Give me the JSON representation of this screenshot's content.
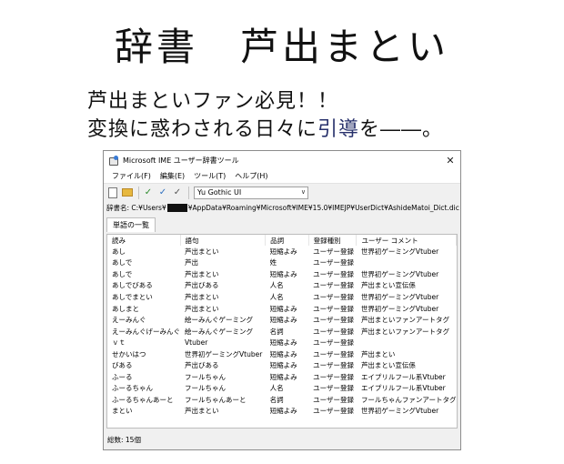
{
  "poster": {
    "title": "辞書　芦出まとい",
    "headline_line1": "芦出まといファン必見！！",
    "headline_line2_a": "変換に惑わされる日々に",
    "headline_line2_b": "引導",
    "headline_line2_c": "を――。"
  },
  "window": {
    "title": "Microsoft IME ユーザー辞書ツール",
    "close_glyph": "✕",
    "menu": [
      "ファイル(F)",
      "編集(E)",
      "ツール(T)",
      "ヘルプ(H)"
    ],
    "font_select_value": "Yu Gothic UI",
    "dict_path_prefix": "辞書名: C:¥Users¥",
    "dict_path_suffix": "¥AppData¥Roaming¥Microsoft¥IME¥15.0¥IMEJP¥UserDict¥AshideMatoi_Dict.dic",
    "tab_label": "単語の一覧",
    "columns": [
      "読み",
      "語句",
      "品詞",
      "登録種別",
      "ユーザー コメント"
    ],
    "rows": [
      [
        "あし",
        "芦出まとい",
        "短縮よみ",
        "ユーザー登録",
        "世界初ゲーミングVtuber"
      ],
      [
        "あしで",
        "芦出",
        "姓",
        "ユーザー登録",
        ""
      ],
      [
        "あしで",
        "芦出まとい",
        "短縮よみ",
        "ユーザー登録",
        "世界初ゲーミングVtuber"
      ],
      [
        "あしでびある",
        "芦出びある",
        "人名",
        "ユーザー登録",
        "芦出まとい宣伝係"
      ],
      [
        "あしでまとい",
        "芦出まとい",
        "人名",
        "ユーザー登録",
        "世界初ゲーミングVtuber"
      ],
      [
        "あしまと",
        "芦出まとい",
        "短縮よみ",
        "ユーザー登録",
        "世界初ゲーミングVtuber"
      ],
      [
        "えーみんぐ",
        "絵ーみんぐゲーミング",
        "短縮よみ",
        "ユーザー登録",
        "芦出まといファンアートタグ"
      ],
      [
        "えーみんぐげーみんぐ",
        "絵ーみんぐゲーミング",
        "名詞",
        "ユーザー登録",
        "芦出まといファンアートタグ"
      ],
      [
        "ｖｔ",
        "Vtuber",
        "短縮よみ",
        "ユーザー登録",
        ""
      ],
      [
        "せかいはつ",
        "世界初ゲーミングVtuber",
        "短縮よみ",
        "ユーザー登録",
        "芦出まとい"
      ],
      [
        "びある",
        "芦出びある",
        "短縮よみ",
        "ユーザー登録",
        "芦出まとい宣伝係"
      ],
      [
        "ふーる",
        "フールちゃん",
        "短縮よみ",
        "ユーザー登録",
        "エイプリルフール系Vtuber"
      ],
      [
        "ふーるちゃん",
        "フールちゃん",
        "人名",
        "ユーザー登録",
        "エイプリルフール系Vtuber"
      ],
      [
        "ふーるちゃんあーと",
        "フールちゃんあーと",
        "名詞",
        "ユーザー登録",
        "フールちゃんファンアートタグ"
      ],
      [
        "まとい",
        "芦出まとい",
        "短縮よみ",
        "ユーザー登録",
        "世界初ゲーミングVtuber"
      ]
    ],
    "status": "総数: 15個"
  }
}
